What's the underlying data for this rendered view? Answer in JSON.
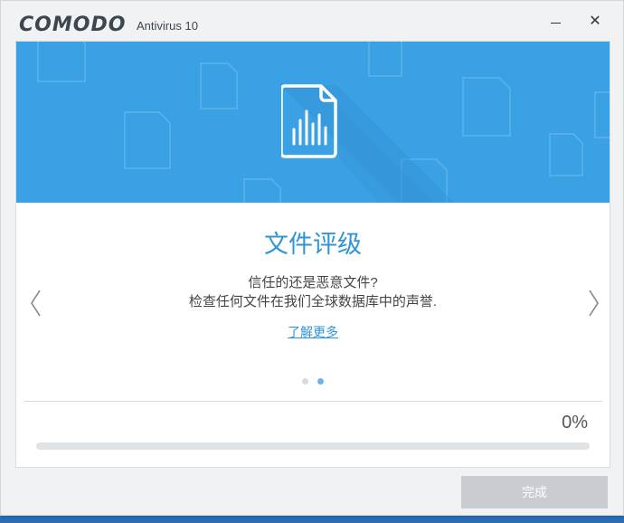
{
  "window": {
    "brand": "COMODO",
    "product": "Antivirus 10",
    "minimize_glyph": "—",
    "close_glyph": "✕"
  },
  "slide": {
    "icon": "file-rating-icon",
    "headline": "文件评级",
    "line1": "信任的还是恶意文件?",
    "line2": "检查任何文件在我们全球数据库中的声誉.",
    "learn_more": "了解更多",
    "slide_count": 2,
    "active_slide": 2
  },
  "progress": {
    "percent_label": "0%",
    "value": 0
  },
  "footer": {
    "finish_label": "完成"
  },
  "colors": {
    "accent": "#3aa1e4",
    "headline": "#2f95d8",
    "banner_bg": "#3aa1e4"
  }
}
